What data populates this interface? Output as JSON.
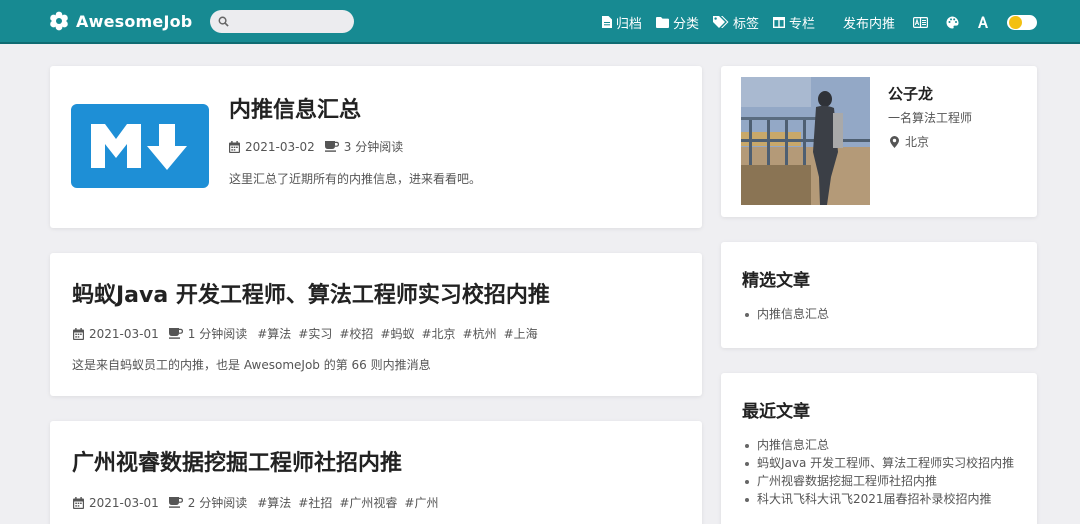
{
  "navbar": {
    "brand": "AwesomeJob",
    "search_placeholder": "",
    "links": [
      {
        "label": "归档",
        "icon": "file-icon"
      },
      {
        "label": "分类",
        "icon": "folder-icon"
      },
      {
        "label": "标签",
        "icon": "tags-icon"
      },
      {
        "label": "专栏",
        "icon": "columns-icon"
      }
    ],
    "publish": "发布内推",
    "toggle_state": "light",
    "colors": {
      "bar": "#178a92",
      "toggle_sun": "#f3c012"
    }
  },
  "posts": [
    {
      "title": "内推信息汇总",
      "date": "2021-03-02",
      "reading_time": "3 分钟阅读",
      "tags": [],
      "summary": "这里汇总了近期所有的内推信息，进来看看吧。",
      "thumbnail": "markdown-logo"
    },
    {
      "title": "蚂蚁Java 开发工程师、算法工程师实习校招内推",
      "date": "2021-03-01",
      "reading_time": "1 分钟阅读",
      "tags": [
        "#算法",
        "#实习",
        "#校招",
        "#蚂蚁",
        "#北京",
        "#杭州",
        "#上海"
      ],
      "summary": "这是来自蚂蚁员工的内推，也是 AwesomeJob 的第 66 则内推消息"
    },
    {
      "title": "广州视睿数据挖掘工程师社招内推",
      "date": "2021-03-01",
      "reading_time": "2 分钟阅读",
      "tags": [
        "#算法",
        "#社招",
        "#广州视睿",
        "#广州"
      ],
      "summary": ""
    }
  ],
  "sidebar": {
    "author": {
      "name": "公子龙",
      "bio": "一名算法工程师",
      "location": "北京"
    },
    "featured": {
      "title": "精选文章",
      "items": [
        "内推信息汇总"
      ]
    },
    "recent": {
      "title": "最近文章",
      "items": [
        "内推信息汇总",
        "蚂蚁Java 开发工程师、算法工程师实习校招内推",
        "广州视睿数据挖掘工程师社招内推",
        "科大讯飞科大讯飞2021届春招补录校招内推"
      ]
    }
  }
}
